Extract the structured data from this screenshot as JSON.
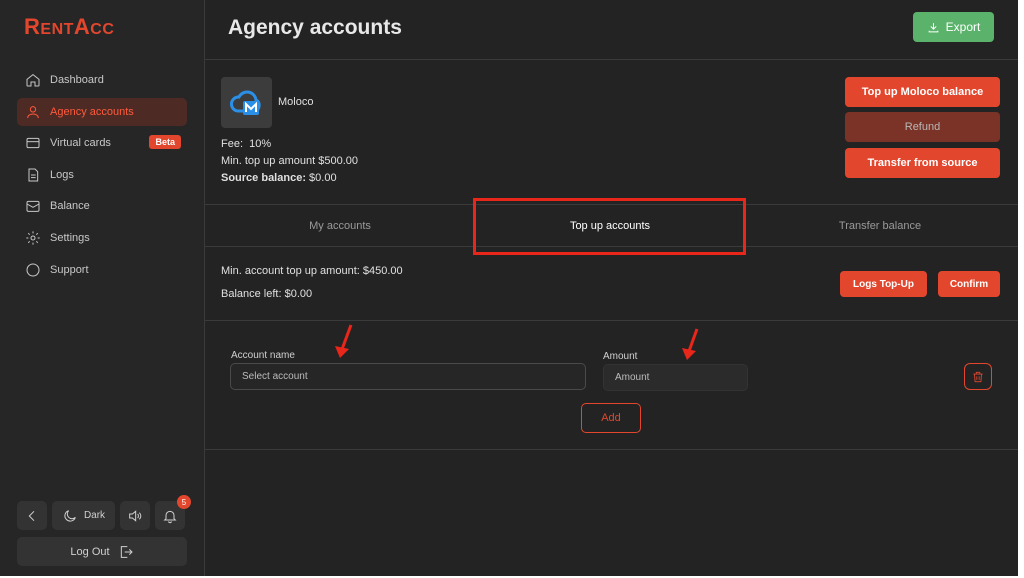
{
  "brand": {
    "logo_text_a": "R",
    "logo_text_b": "ENT",
    "logo_text_c": "A",
    "logo_text_d": "CC",
    "accent": "#e2472e"
  },
  "sidebar": {
    "items": [
      {
        "label": "Dashboard",
        "icon": "home-icon"
      },
      {
        "label": "Agency accounts",
        "icon": "user-icon",
        "active": true
      },
      {
        "label": "Virtual cards",
        "icon": "card-icon",
        "badge": "Beta"
      },
      {
        "label": "Logs",
        "icon": "document-icon"
      },
      {
        "label": "Balance",
        "icon": "wallet-icon"
      },
      {
        "label": "Settings",
        "icon": "gear-icon"
      },
      {
        "label": "Support",
        "icon": "chat-icon"
      }
    ],
    "theme_label": "Dark",
    "notification_count": "5",
    "logout_label": "Log Out"
  },
  "header": {
    "title": "Agency accounts",
    "export_label": "Export"
  },
  "source": {
    "name": "Moloco",
    "fee_label": "Fee:",
    "fee_value": "10%",
    "min_topup": "Min. top up amount $500.00",
    "source_balance_label": "Source balance:",
    "source_balance_value": "$0.00",
    "buttons": {
      "top_up": "Top up Moloco balance",
      "refund": "Refund",
      "transfer": "Transfer from source"
    }
  },
  "tabs": [
    {
      "label": "My accounts"
    },
    {
      "label": "Top up accounts",
      "active": true
    },
    {
      "label": "Transfer balance"
    }
  ],
  "summary": {
    "min_account_topup": "Min. account top up amount: $450.00",
    "balance_left": "Balance left: $0.00",
    "logs_button": "Logs Top-Up",
    "confirm_button": "Confirm"
  },
  "form": {
    "account_label": "Account name",
    "account_placeholder": "Select account",
    "amount_label": "Amount",
    "amount_placeholder": "Amount",
    "add_label": "Add"
  }
}
